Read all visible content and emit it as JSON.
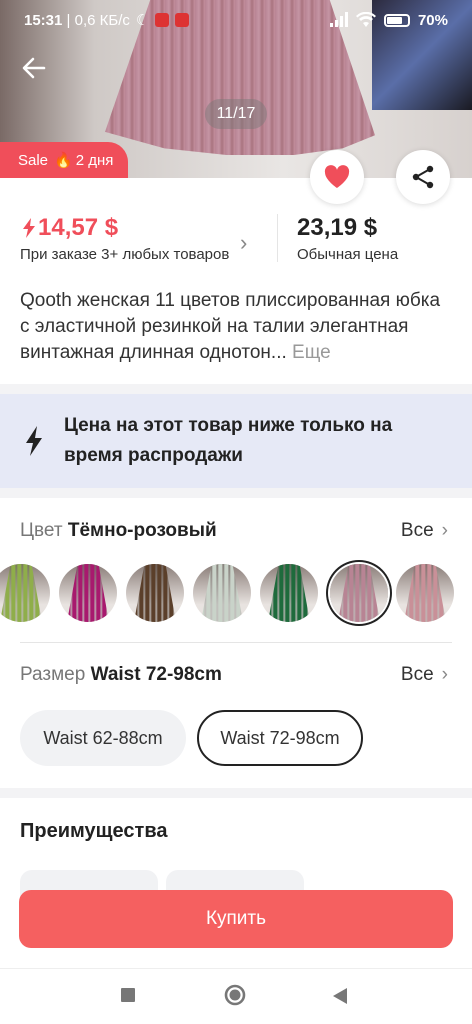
{
  "status_bar": {
    "time": "15:31",
    "network_speed": "0,6 КБ/с",
    "battery_percent": "70%"
  },
  "gallery": {
    "counter": "11/17"
  },
  "sale_badge": {
    "label": "Sale",
    "duration": "2 дня",
    "color": "#f04e5a"
  },
  "price": {
    "promo_price": "14,57 $",
    "promo_note": "При заказе 3+ любых товаров",
    "regular_price": "23,19 $",
    "regular_note": "Обычная цена",
    "promo_color": "#f04e5a"
  },
  "product": {
    "title": "Qooth женская 11 цветов плиссированная юбка с эластичной резинкой на талии элегантная винтажная длинная однотон...",
    "more_label": "Еще"
  },
  "banner": {
    "text": "Цена на этот товар ниже только на время распродажи",
    "background": "#e6e9f6"
  },
  "color_option": {
    "label": "Цвет",
    "selected": "Тёмно-розовый",
    "all_label": "Все",
    "swatches": [
      {
        "color": "#8fae4a"
      },
      {
        "color": "#a8196e"
      },
      {
        "color": "#5b3f2a"
      },
      {
        "color": "#c9d3c9"
      },
      {
        "color": "#1e6b3c"
      },
      {
        "color": "#b88494"
      },
      {
        "color": "#c99098"
      }
    ]
  },
  "size_option": {
    "label": "Размер",
    "selected": "Waist 72-98cm",
    "all_label": "Все",
    "sizes": [
      "Waist 62-88cm",
      "Waist 72-98cm"
    ]
  },
  "benefits": {
    "title": "Преимущества"
  },
  "buy_button": {
    "label": "Купить",
    "color": "#f56060"
  }
}
